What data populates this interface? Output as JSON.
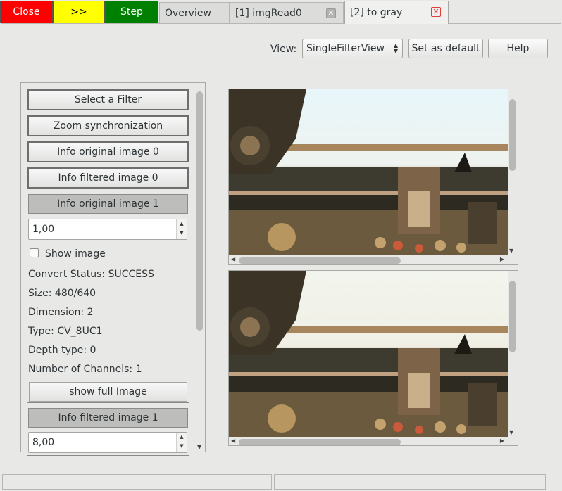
{
  "top_buttons": {
    "close": "Close",
    "next": ">>",
    "step": "Step"
  },
  "tabs": [
    {
      "label": "Overview"
    },
    {
      "label": "[1] imgRead0"
    },
    {
      "label": "[2] to gray"
    }
  ],
  "toolbar": {
    "view_label": "View:",
    "view_value": "SingleFilterView",
    "set_default": "Set as default",
    "help": "Help"
  },
  "left_panel": {
    "select_filter": "Select a Filter",
    "zoom_sync": "Zoom synchronization",
    "info_original_0": "Info original image 0",
    "info_filtered_0": "Info filtered image 0",
    "original_1": {
      "header": "Info original image 1",
      "zoom_value": "1,00",
      "show_image": "Show image",
      "convert_status": "Convert Status: SUCCESS",
      "size": "Size: 480/640",
      "dimension": "Dimension: 2",
      "type": "Type: CV_8UC1",
      "depth": "Depth type: 0",
      "channels": "Number of Channels: 1",
      "show_full": "show full Image"
    },
    "filtered_1": {
      "header": "Info filtered image 1",
      "zoom_value": "8,00"
    }
  },
  "images": [
    {
      "name": "original image view"
    },
    {
      "name": "filtered image view"
    }
  ],
  "colors": {
    "close": "#ff0000",
    "next": "#ffff00",
    "step": "#008000",
    "tab_close": "#e23c3c"
  },
  "icons": [
    "close-tab-icon",
    "spin-arrows-icon",
    "scroll-arrow-icon",
    "dropdown-arrows-icon"
  ]
}
